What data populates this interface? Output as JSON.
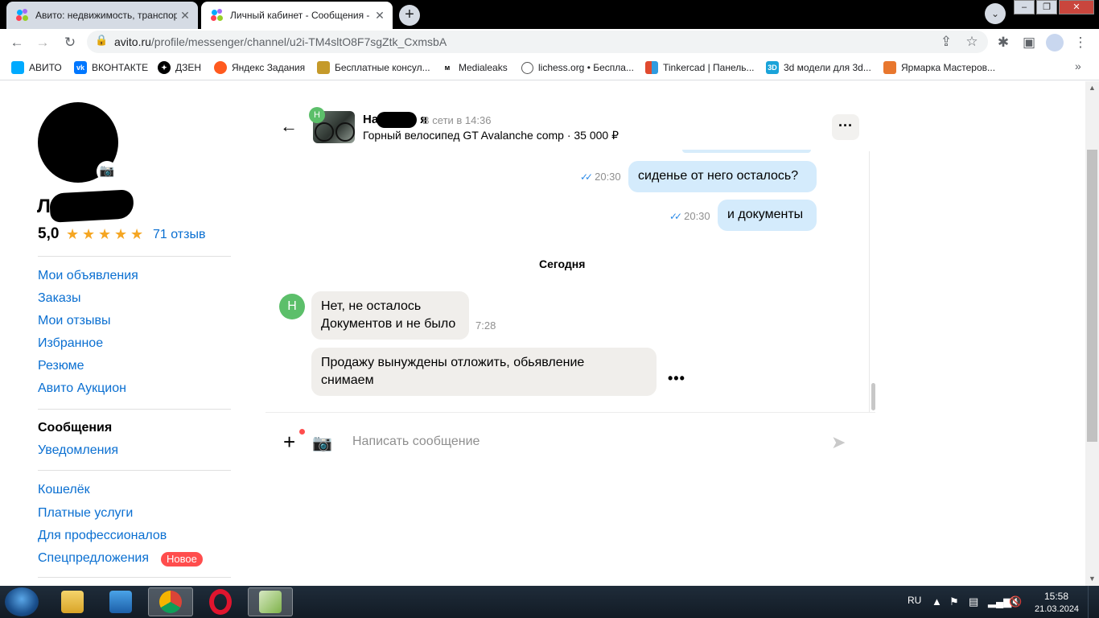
{
  "browser": {
    "tabs": [
      {
        "title": "Авито: недвижимость, транспор",
        "active": false
      },
      {
        "title": "Личный кабинет - Сообщения -",
        "active": true
      }
    ],
    "new_tab": "+",
    "url_host": "avito.ru",
    "url_path": "/profile/messenger/channel/u2i-TM4sltO8F7sgZtk_CxmsbA",
    "bookmarks": [
      {
        "label": "АВИТО",
        "color": "#00aaff"
      },
      {
        "label": "ВКОНТАКТЕ",
        "color": "#0077ff"
      },
      {
        "label": "ДЗЕН",
        "color": "#000000"
      },
      {
        "label": "Яндекс Задания",
        "color": "#ff5a1f"
      },
      {
        "label": "Бесплатные консул...",
        "color": "#c59a2a"
      },
      {
        "label": "Medialeaks",
        "color": "#f2c200"
      },
      {
        "label": "lichess.org • Беспла...",
        "color": "#555555"
      },
      {
        "label": "Tinkercad | Панель...",
        "color": "#e04a2f"
      },
      {
        "label": "3d модели для 3d...",
        "color": "#1aa3d9"
      },
      {
        "label": "Ярмарка Мастеров...",
        "color": "#e8772e"
      }
    ]
  },
  "profile": {
    "name_initial": "Л",
    "rating": "5,0",
    "reviews": "71 отзыв",
    "nav_group1": [
      "Мои объявления",
      "Заказы",
      "Мои отзывы",
      "Избранное",
      "Резюме",
      "Авито Аукцион"
    ],
    "nav_group2": [
      "Сообщения",
      "Уведомления"
    ],
    "nav_group3": [
      "Кошелёк",
      "Платные услуги",
      "Для профессионалов",
      "Спецпредложения"
    ],
    "badge_new": "Новое"
  },
  "chat": {
    "contact_initial": "Н",
    "contact_name_visible": "На",
    "contact_name_tail": "я",
    "status": "В сети в 14:36",
    "item": "Горный велосипед GT Avalanche comp · 35 000 ₽",
    "messages_out": [
      {
        "time": "20:30",
        "text": "сиденье от него осталось?"
      },
      {
        "time": "20:30",
        "text": "и документы"
      }
    ],
    "day_separator": "Сегодня",
    "messages_in": [
      {
        "line1": "Нет, не осталось",
        "line2": "Документов и не было",
        "time": "7:28"
      },
      {
        "line1": "Продажу вынуждены отложить, обьявление",
        "line2": "снимаем"
      }
    ],
    "input_placeholder": "Написать сообщение"
  },
  "taskbar": {
    "lang": "RU",
    "time": "15:58",
    "date": "21.03.2024"
  }
}
